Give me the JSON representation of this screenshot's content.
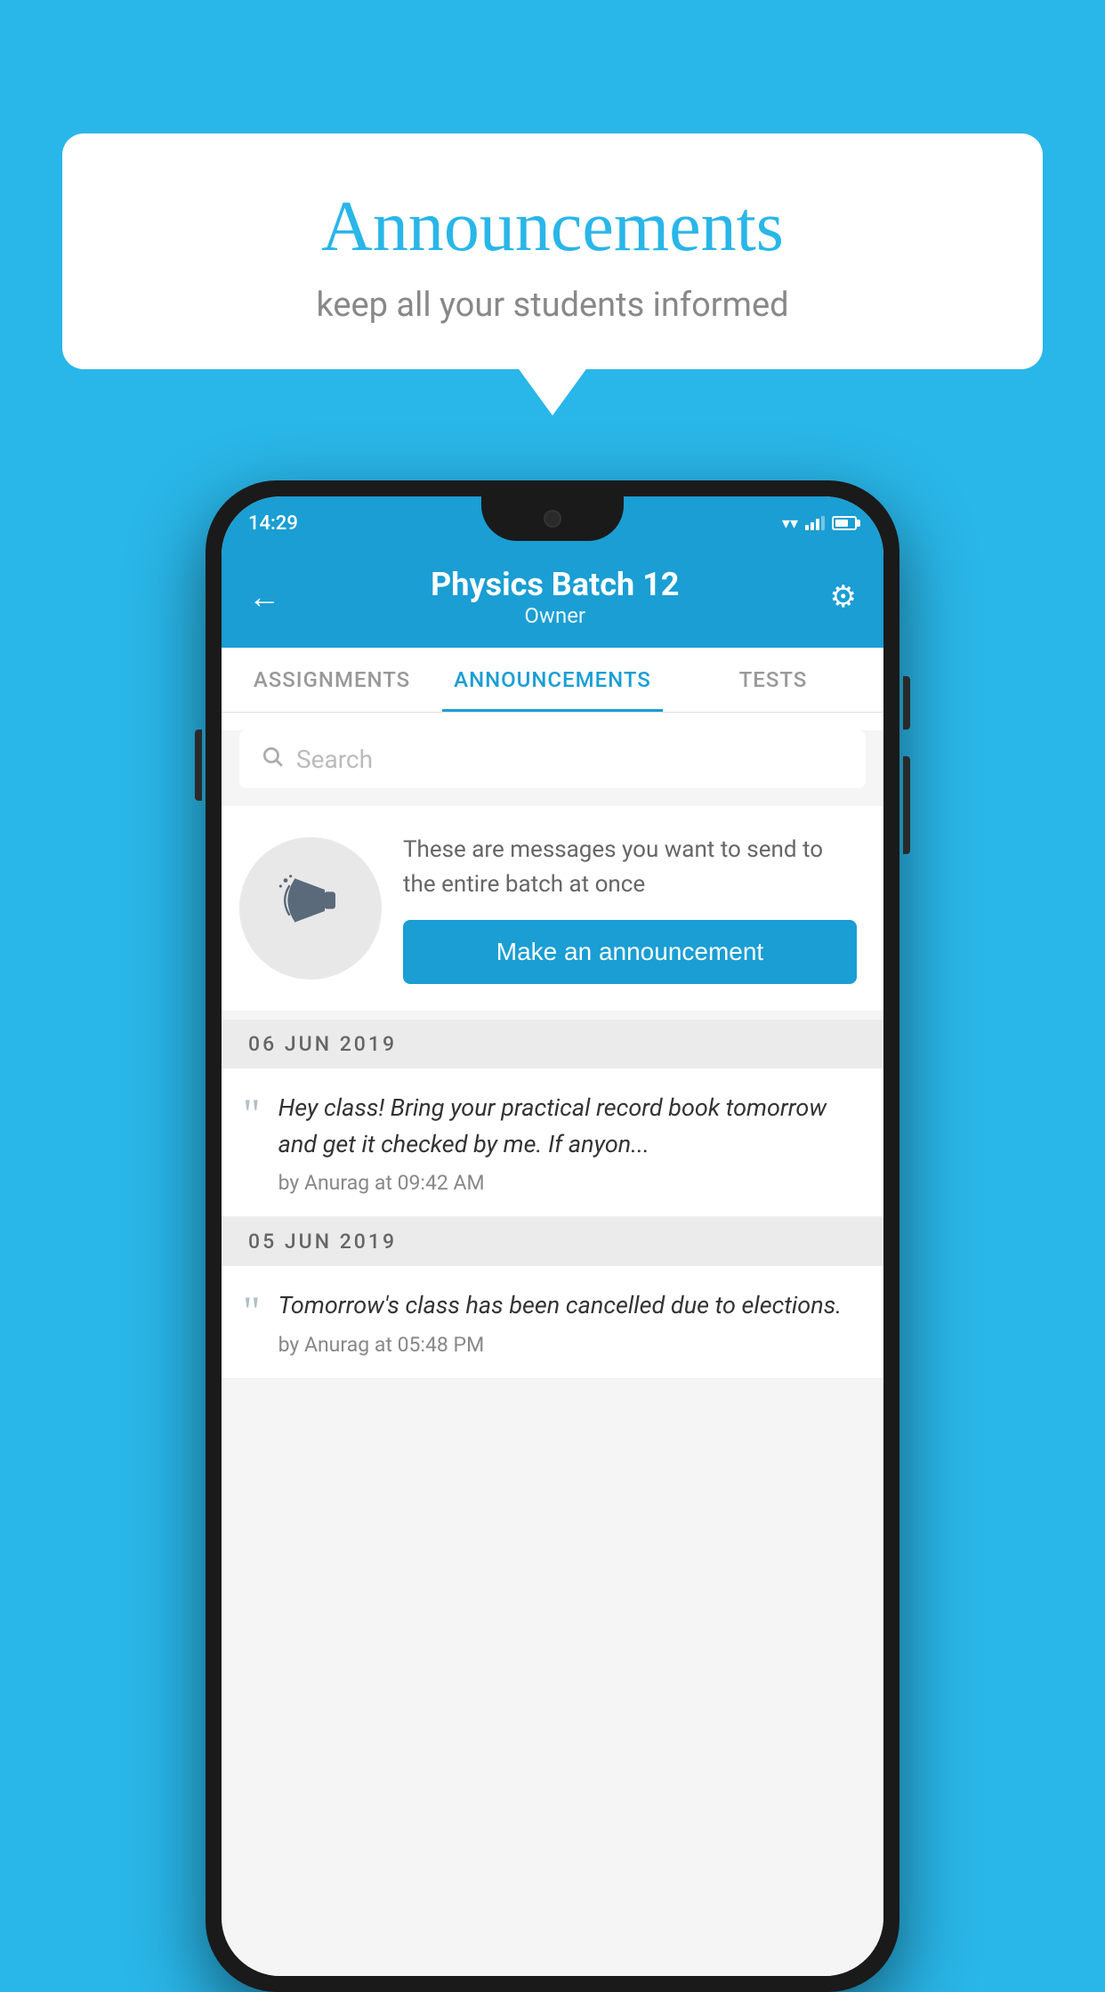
{
  "background_color": "#29b6e8",
  "speech_bubble": {
    "title": "Announcements",
    "subtitle": "keep all your students informed"
  },
  "phone": {
    "status_bar": {
      "time": "14:29"
    },
    "header": {
      "title": "Physics Batch 12",
      "subtitle": "Owner",
      "back_label": "←",
      "gear_label": "⚙"
    },
    "tabs": [
      {
        "label": "ASSIGNMENTS",
        "active": false
      },
      {
        "label": "ANNOUNCEMENTS",
        "active": true
      },
      {
        "label": "TESTS",
        "active": false
      }
    ],
    "search": {
      "placeholder": "Search"
    },
    "promo": {
      "description": "These are messages you want to send to the entire batch at once",
      "button_label": "Make an announcement"
    },
    "announcements": [
      {
        "date": "06  JUN  2019",
        "text": "Hey class! Bring your practical record book tomorrow and get it checked by me. If anyon...",
        "author": "by Anurag at 09:42 AM"
      },
      {
        "date": "05  JUN  2019",
        "text": "Tomorrow's class has been cancelled due to elections.",
        "author": "by Anurag at 05:48 PM"
      }
    ]
  }
}
